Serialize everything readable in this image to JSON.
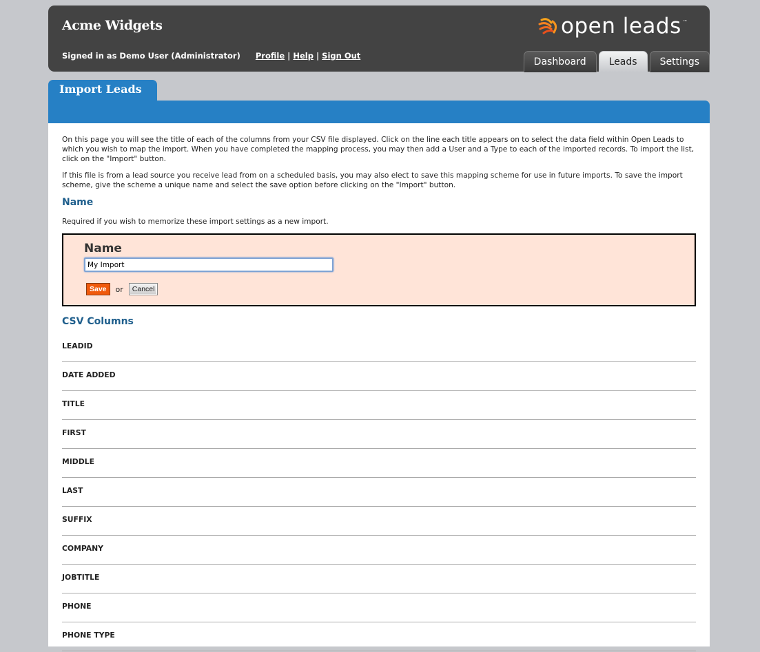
{
  "header": {
    "brand": "Acme Widgets",
    "signed_in": "Signed in as Demo User (Administrator)",
    "links": [
      {
        "label": "Profile"
      },
      {
        "label": "Help"
      },
      {
        "label": "Sign Out"
      }
    ],
    "logo_text": "open leads",
    "logo_tm": "™",
    "logo_icon": "swirl-logo-icon",
    "tabs": [
      {
        "label": "Dashboard",
        "active": false
      },
      {
        "label": "Leads",
        "active": true
      },
      {
        "label": "Settings",
        "active": false
      }
    ]
  },
  "page": {
    "title": "Import Leads",
    "intro_1": "On this page you will see the title of each of the columns from your CSV file displayed. Click on the line each title appears on to select the data field within Open Leads to which you wish to map the import. When you have completed the mapping process, you may then add a User and a Type to each of the imported records. To import the list, click on the \"Import\" button.",
    "intro_2": "If this file is from a lead source you receive lead from on a scheduled basis, you may also elect to save this mapping scheme for use in future imports. To save the import scheme, give the scheme a unique name and select the save option before clicking on the \"Import\" button.",
    "name_heading": "Name",
    "name_help": "Required if you wish to memorize these import settings as a new import.",
    "name_form": {
      "label": "Name",
      "value": "My Import",
      "save_label": "Save",
      "or_label": "or",
      "cancel_label": "Cancel"
    },
    "csv_heading": "CSV Columns",
    "columns": [
      "LEADID",
      "DATE ADDED",
      "TITLE",
      "FIRST",
      "MIDDLE",
      "LAST",
      "SUFFIX",
      "COMPANY",
      "JOBTITLE",
      "PHONE",
      "PHONE TYPE"
    ]
  },
  "colors": {
    "accent_blue": "#2680c5",
    "header_bg": "#434343",
    "heading_blue": "#1e5e8c",
    "save_orange": "#f05a0c",
    "form_bg": "#ffe4d8"
  }
}
